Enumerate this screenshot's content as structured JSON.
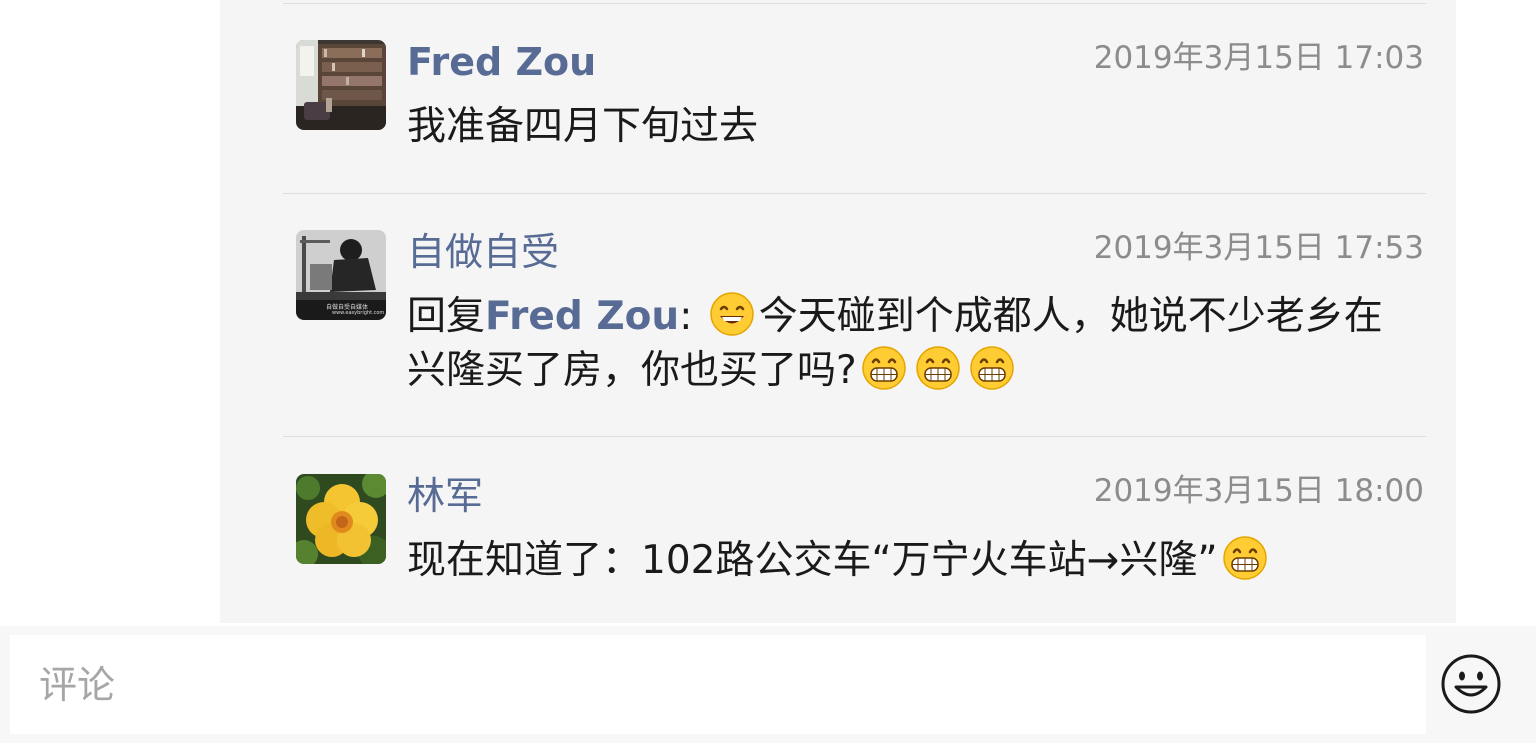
{
  "comments": [
    {
      "author": "Fred Zou",
      "time": "2019年3月15日 17:03",
      "text": "我准备四月下旬过去",
      "avatar": "bookshelf-library-photo"
    },
    {
      "author": "自做自受",
      "time": "2019年3月15日 17:53",
      "reply_prefix": "回复",
      "reply_to": "Fred Zou",
      "reply_colon": ": ",
      "text_a": "今天碰到个成都人，她说不少老乡在兴隆买了房，你也买了吗?",
      "avatar": "black-white-vintage-photo",
      "avatar_caption": "自做自受自媒体",
      "avatar_url": "www.easybright.com",
      "emojis": [
        "smile-emoji",
        "grin-emoji",
        "grin-emoji",
        "grin-emoji"
      ]
    },
    {
      "author": "林军",
      "time": "2019年3月15日 18:00",
      "text": "现在知道了：102路公交车“万宁火车站→兴隆”",
      "avatar": "yellow-flower-photo",
      "emojis": [
        "grin-emoji"
      ]
    }
  ],
  "input": {
    "placeholder": "评论"
  },
  "colors": {
    "name_blue": "#576b95",
    "time_gray": "#8c8c8c",
    "panel_bg": "#f5f5f5"
  },
  "icons": [
    "emoji-face-icon"
  ]
}
